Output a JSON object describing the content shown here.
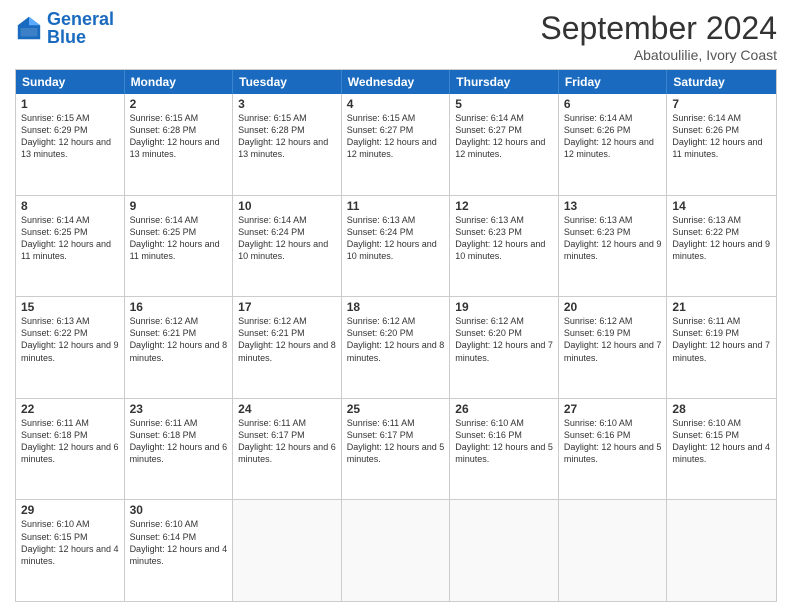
{
  "logo": {
    "line1": "General",
    "line2": "Blue"
  },
  "title": "September 2024",
  "subtitle": "Abatoulilie, Ivory Coast",
  "days": [
    "Sunday",
    "Monday",
    "Tuesday",
    "Wednesday",
    "Thursday",
    "Friday",
    "Saturday"
  ],
  "weeks": [
    [
      {
        "day": "1",
        "sunrise": "6:15 AM",
        "sunset": "6:29 PM",
        "daylight": "12 hours and 13 minutes."
      },
      {
        "day": "2",
        "sunrise": "6:15 AM",
        "sunset": "6:28 PM",
        "daylight": "12 hours and 13 minutes."
      },
      {
        "day": "3",
        "sunrise": "6:15 AM",
        "sunset": "6:28 PM",
        "daylight": "12 hours and 13 minutes."
      },
      {
        "day": "4",
        "sunrise": "6:15 AM",
        "sunset": "6:27 PM",
        "daylight": "12 hours and 12 minutes."
      },
      {
        "day": "5",
        "sunrise": "6:14 AM",
        "sunset": "6:27 PM",
        "daylight": "12 hours and 12 minutes."
      },
      {
        "day": "6",
        "sunrise": "6:14 AM",
        "sunset": "6:26 PM",
        "daylight": "12 hours and 12 minutes."
      },
      {
        "day": "7",
        "sunrise": "6:14 AM",
        "sunset": "6:26 PM",
        "daylight": "12 hours and 11 minutes."
      }
    ],
    [
      {
        "day": "8",
        "sunrise": "6:14 AM",
        "sunset": "6:25 PM",
        "daylight": "12 hours and 11 minutes."
      },
      {
        "day": "9",
        "sunrise": "6:14 AM",
        "sunset": "6:25 PM",
        "daylight": "12 hours and 11 minutes."
      },
      {
        "day": "10",
        "sunrise": "6:14 AM",
        "sunset": "6:24 PM",
        "daylight": "12 hours and 10 minutes."
      },
      {
        "day": "11",
        "sunrise": "6:13 AM",
        "sunset": "6:24 PM",
        "daylight": "12 hours and 10 minutes."
      },
      {
        "day": "12",
        "sunrise": "6:13 AM",
        "sunset": "6:23 PM",
        "daylight": "12 hours and 10 minutes."
      },
      {
        "day": "13",
        "sunrise": "6:13 AM",
        "sunset": "6:23 PM",
        "daylight": "12 hours and 9 minutes."
      },
      {
        "day": "14",
        "sunrise": "6:13 AM",
        "sunset": "6:22 PM",
        "daylight": "12 hours and 9 minutes."
      }
    ],
    [
      {
        "day": "15",
        "sunrise": "6:13 AM",
        "sunset": "6:22 PM",
        "daylight": "12 hours and 9 minutes."
      },
      {
        "day": "16",
        "sunrise": "6:12 AM",
        "sunset": "6:21 PM",
        "daylight": "12 hours and 8 minutes."
      },
      {
        "day": "17",
        "sunrise": "6:12 AM",
        "sunset": "6:21 PM",
        "daylight": "12 hours and 8 minutes."
      },
      {
        "day": "18",
        "sunrise": "6:12 AM",
        "sunset": "6:20 PM",
        "daylight": "12 hours and 8 minutes."
      },
      {
        "day": "19",
        "sunrise": "6:12 AM",
        "sunset": "6:20 PM",
        "daylight": "12 hours and 7 minutes."
      },
      {
        "day": "20",
        "sunrise": "6:12 AM",
        "sunset": "6:19 PM",
        "daylight": "12 hours and 7 minutes."
      },
      {
        "day": "21",
        "sunrise": "6:11 AM",
        "sunset": "6:19 PM",
        "daylight": "12 hours and 7 minutes."
      }
    ],
    [
      {
        "day": "22",
        "sunrise": "6:11 AM",
        "sunset": "6:18 PM",
        "daylight": "12 hours and 6 minutes."
      },
      {
        "day": "23",
        "sunrise": "6:11 AM",
        "sunset": "6:18 PM",
        "daylight": "12 hours and 6 minutes."
      },
      {
        "day": "24",
        "sunrise": "6:11 AM",
        "sunset": "6:17 PM",
        "daylight": "12 hours and 6 minutes."
      },
      {
        "day": "25",
        "sunrise": "6:11 AM",
        "sunset": "6:17 PM",
        "daylight": "12 hours and 5 minutes."
      },
      {
        "day": "26",
        "sunrise": "6:10 AM",
        "sunset": "6:16 PM",
        "daylight": "12 hours and 5 minutes."
      },
      {
        "day": "27",
        "sunrise": "6:10 AM",
        "sunset": "6:16 PM",
        "daylight": "12 hours and 5 minutes."
      },
      {
        "day": "28",
        "sunrise": "6:10 AM",
        "sunset": "6:15 PM",
        "daylight": "12 hours and 4 minutes."
      }
    ],
    [
      {
        "day": "29",
        "sunrise": "6:10 AM",
        "sunset": "6:15 PM",
        "daylight": "12 hours and 4 minutes."
      },
      {
        "day": "30",
        "sunrise": "6:10 AM",
        "sunset": "6:14 PM",
        "daylight": "12 hours and 4 minutes."
      },
      {
        "day": "",
        "sunrise": "",
        "sunset": "",
        "daylight": ""
      },
      {
        "day": "",
        "sunrise": "",
        "sunset": "",
        "daylight": ""
      },
      {
        "day": "",
        "sunrise": "",
        "sunset": "",
        "daylight": ""
      },
      {
        "day": "",
        "sunrise": "",
        "sunset": "",
        "daylight": ""
      },
      {
        "day": "",
        "sunrise": "",
        "sunset": "",
        "daylight": ""
      }
    ]
  ]
}
